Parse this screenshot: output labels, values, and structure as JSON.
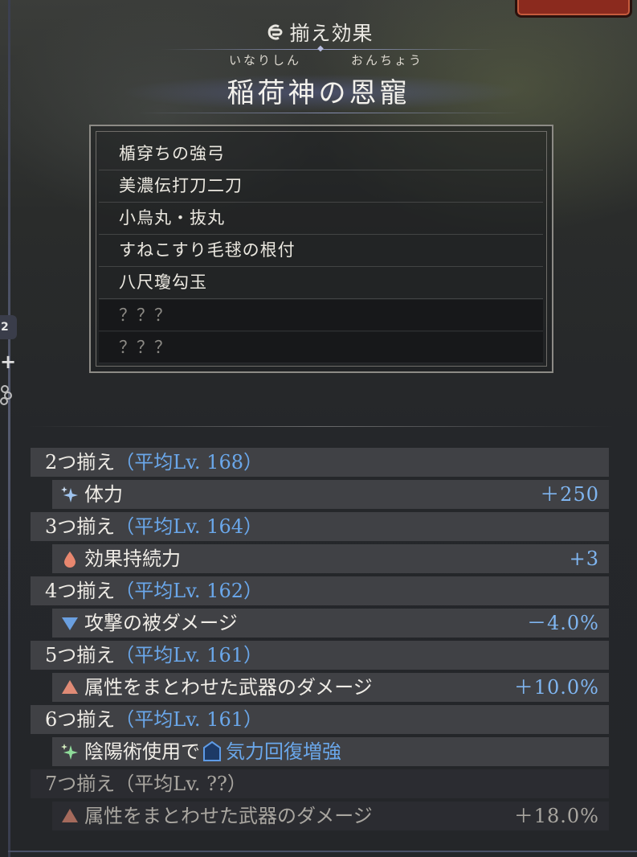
{
  "header": {
    "set_label": "揃え効果",
    "ruby_left": "いなりしん",
    "ruby_right": "おんちょう",
    "set_name": "稲荷神の恩寵"
  },
  "items": [
    "楯穿ちの強弓",
    "美濃伝打刀二刀",
    "小烏丸・抜丸",
    "すねこすり毛毬の根付",
    "八尺瓊勾玉",
    "？？？",
    "？？？"
  ],
  "bonuses": [
    {
      "count": "2つ揃え",
      "avg": "（平均Lv. 168）",
      "icon": "sparkle-icon",
      "effect": "体力",
      "value": "＋250"
    },
    {
      "count": "3つ揃え",
      "avg": "（平均Lv. 164）",
      "icon": "drop-icon",
      "effect": "効果持続力",
      "value": "+3"
    },
    {
      "count": "4つ揃え",
      "avg": "（平均Lv. 162）",
      "icon": "down-triangle-icon",
      "effect": "攻撃の被ダメージ",
      "value": "－4.0%"
    },
    {
      "count": "5つ揃え",
      "avg": "（平均Lv. 161）",
      "icon": "up-triangle-icon",
      "effect": "属性をまとわせた武器のダメージ",
      "value": "＋10.0%"
    },
    {
      "count": "6つ揃え",
      "avg": "（平均Lv. 161）",
      "icon": "sparkle-icon",
      "effect": "陰陽術使用で",
      "effect_extra": "気力回復増強",
      "value": ""
    },
    {
      "count": "7つ揃え",
      "avg": "（平均Lv. ??）",
      "icon": "up-triangle-icon",
      "effect": "属性をまとわせた武器のダメージ",
      "value": "＋18.0%"
    }
  ],
  "side": {
    "badge": "2",
    "plus": "+"
  },
  "colors": {
    "accent_blue": "#6aa7ea",
    "value_blue": "#7fb5f0",
    "row_bg": "#48494d",
    "locked_bg": "#2d2e32"
  }
}
